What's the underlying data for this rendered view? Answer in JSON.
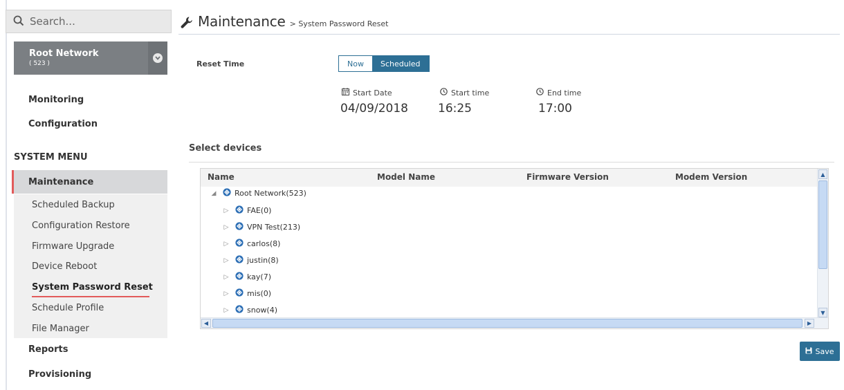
{
  "search": {
    "placeholder": "Search..."
  },
  "network": {
    "title": "Root Network",
    "count": "( 523 )"
  },
  "menu": {
    "monitoring": "Monitoring",
    "configuration": "Configuration",
    "system_menu": "SYSTEM MENU",
    "maintenance": "Maintenance",
    "sub_items": [
      "Scheduled Backup",
      "Configuration Restore",
      "Firmware Upgrade",
      "Device Reboot",
      "System Password Reset",
      "Schedule Profile",
      "File Manager"
    ],
    "active_sub_item": "System Password Reset",
    "reports": "Reports",
    "provisioning": "Provisioning"
  },
  "header": {
    "title": "Maintenance",
    "breadcrumb": "> System Password Reset"
  },
  "reset_time": {
    "label": "Reset Time",
    "options": [
      "Now",
      "Scheduled"
    ],
    "selected": "Scheduled"
  },
  "schedule": {
    "start_date_label": "Start Date",
    "start_date": "04/09/2018",
    "start_time_label": "Start time",
    "start_time": "16:25",
    "end_time_label": "End time",
    "end_time": "17:00"
  },
  "devices": {
    "section_title": "Select devices",
    "columns": [
      "Name",
      "Model Name",
      "Firmware Version",
      "Modem Version"
    ],
    "root": "Root Network(523)",
    "children": [
      "FAE(0)",
      "VPN Test(213)",
      "carlos(8)",
      "justin(8)",
      "kay(7)",
      "mis(0)",
      "snow(4)"
    ]
  },
  "save_label": "Save",
  "colors": {
    "accent": "#2d6f95",
    "active_marker": "#e25a5a",
    "network_box": "#7b7f83"
  }
}
